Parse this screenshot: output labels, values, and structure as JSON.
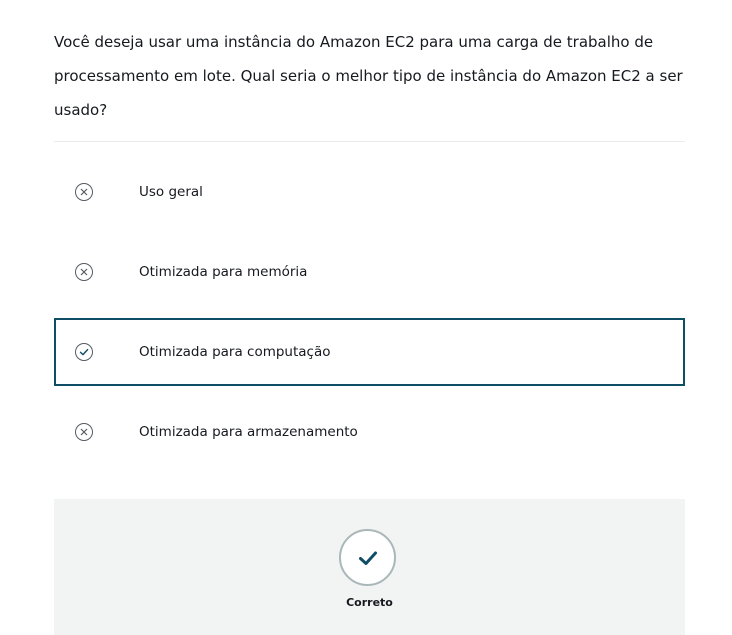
{
  "question": {
    "text": "Você deseja usar uma instância do Amazon EC2 para uma carga de trabalho de processamento em lote. Qual seria o melhor tipo de instância do Amazon EC2 a ser usado?"
  },
  "options": [
    {
      "label": "Uso geral",
      "status": "incorrect",
      "icon": "x-circle-icon"
    },
    {
      "label": "Otimizada para memória",
      "status": "incorrect",
      "icon": "x-circle-icon"
    },
    {
      "label": "Otimizada para computação",
      "status": "correct",
      "icon": "check-circle-icon",
      "selected": true
    },
    {
      "label": "Otimizada para armazenamento",
      "status": "incorrect",
      "icon": "x-circle-icon"
    }
  ],
  "result": {
    "label": "Correto",
    "icon": "checkmark-icon"
  },
  "colors": {
    "selected_border": "#0f4c65",
    "icon_gray": "#545b64",
    "panel_bg": "#f2f3f3",
    "check_color": "#0f4c65"
  }
}
